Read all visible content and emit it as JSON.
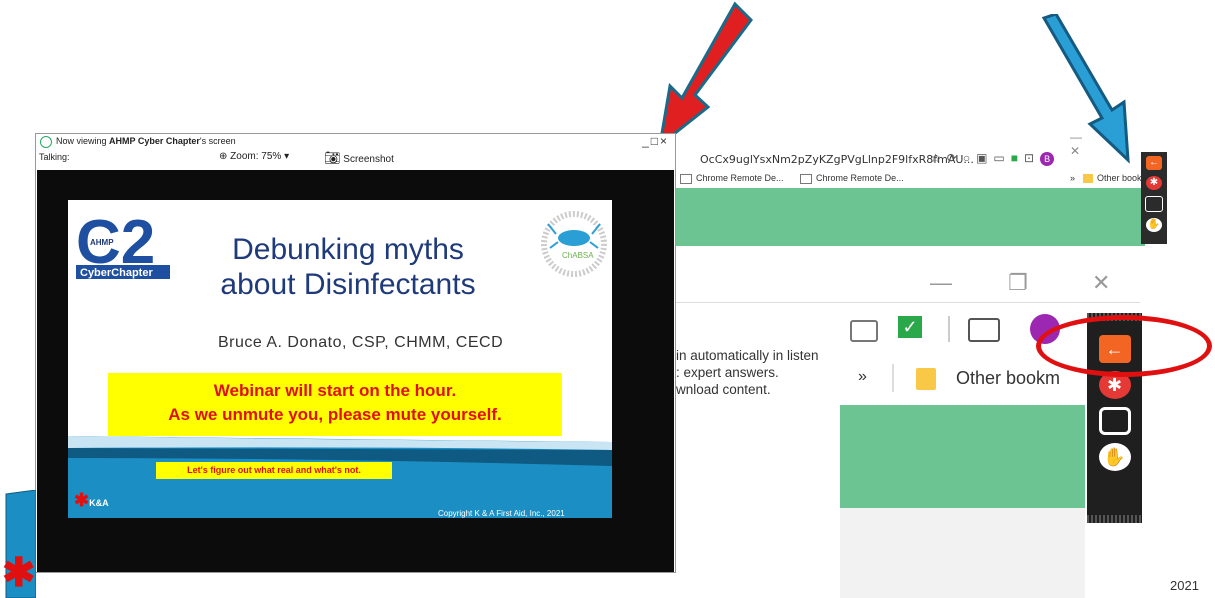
{
  "browser": {
    "url": "OcCx9uglYsxNm2pZyKZgPVgLlnp2F9lfxR8fmAU...",
    "bookmarks": [
      "Chrome Remote De...",
      "Chrome Remote De..."
    ],
    "bookmarks_overflow": "»",
    "other_bookmarks_small": "Other bookm",
    "other_bookmarks_big": "Other bookm",
    "profile_initial": "B",
    "accent_green": "#6cc493"
  },
  "zoom_popup": {
    "text_lines": [
      "in automatically in listen",
      ": expert answers.",
      "wnload content."
    ],
    "overflow_chevron": "»"
  },
  "viewer": {
    "title_prefix": "Now viewing ",
    "title_name": "AHMP Cyber Chapter",
    "title_suffix": "'s screen",
    "talking_label": "Talking:",
    "zoom_label": "Zoom: 75%",
    "screenshot_label": "Screenshot",
    "window_controls": "_□×"
  },
  "slide": {
    "title_line1": "Debunking myths",
    "title_line2": "about Disinfectants",
    "author": "Bruce A. Donato, CSP, CHMM, CECD",
    "banner_line1": "Webinar will start on the hour.",
    "banner_line2": "As we unmute you, please mute yourself.",
    "tagline": "Let's figure out what real and what's not.",
    "copyright": "Copyright K & A First Aid, Inc., 2021",
    "ka_label": "K&A",
    "logo_c2_text": "C2",
    "logo_ahmp": "AHMP",
    "logo_cyber_chapter": "CyberChapter",
    "logo_chabsa": "ChABSA"
  },
  "footer": {
    "year": "2021"
  },
  "colors": {
    "arrow_red": "#e02020",
    "arrow_blue": "#2a9fd6",
    "highlight_red": "#e01010",
    "slide_title_blue": "#1f3a7a",
    "banner_yellow": "#ffff00"
  }
}
